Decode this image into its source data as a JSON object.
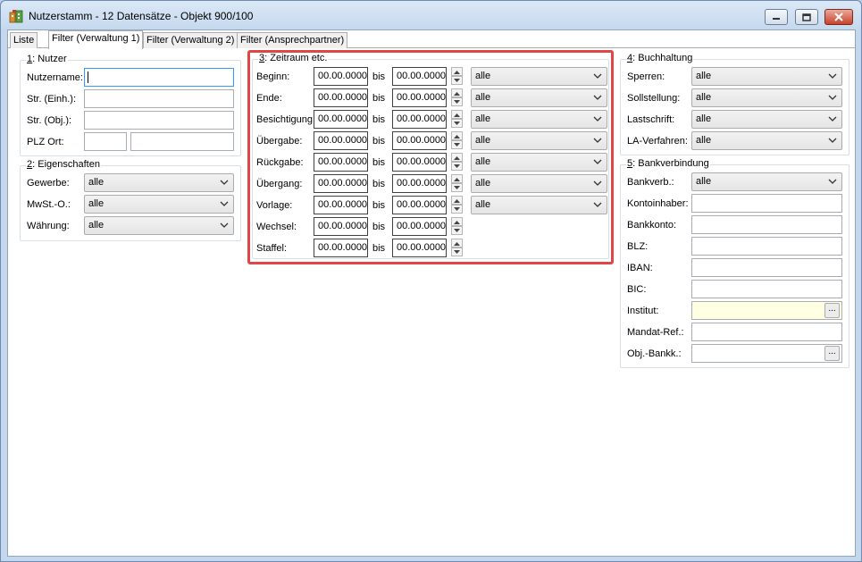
{
  "window": {
    "title": "Nutzerstamm - 12 Datensätze - Objekt 900/100"
  },
  "tabs": [
    "Liste",
    "Filter (Verwaltung 1)",
    "Filter (Verwaltung 2)",
    "Filter (Ansprechpartner)"
  ],
  "nutzer": {
    "title_num": "1",
    "title": ": Nutzer",
    "labels": [
      "Nutzername:",
      "Str. (Einh.):",
      "Str. (Obj.):",
      "PLZ Ort:"
    ]
  },
  "eigenschaften": {
    "title_num": "2",
    "title": ": Eigenschaften",
    "rows": [
      {
        "label": "Gewerbe:",
        "value": "alle"
      },
      {
        "label": "MwSt.-O.:",
        "value": "alle"
      },
      {
        "label": "Währung:",
        "value": "alle"
      }
    ]
  },
  "zeitraum": {
    "title_num": "3",
    "title": ": Zeitraum etc.",
    "bis": "bis",
    "rows": [
      {
        "label": "Beginn:",
        "from": "00.00.0000",
        "to": "00.00.0000",
        "select": "alle"
      },
      {
        "label": "Ende:",
        "from": "00.00.0000",
        "to": "00.00.0000",
        "select": "alle"
      },
      {
        "label": "Besichtigung:",
        "from": "00.00.0000",
        "to": "00.00.0000",
        "select": "alle"
      },
      {
        "label": "Übergabe:",
        "from": "00.00.0000",
        "to": "00.00.0000",
        "select": "alle"
      },
      {
        "label": "Rückgabe:",
        "from": "00.00.0000",
        "to": "00.00.0000",
        "select": "alle"
      },
      {
        "label": "Übergang:",
        "from": "00.00.0000",
        "to": "00.00.0000",
        "select": "alle"
      },
      {
        "label": "Vorlage:",
        "from": "00.00.0000",
        "to": "00.00.0000",
        "select": "alle"
      },
      {
        "label": "Wechsel:",
        "from": "00.00.0000",
        "to": "00.00.0000"
      },
      {
        "label": "Staffel:",
        "from": "00.00.0000",
        "to": "00.00.0000"
      }
    ]
  },
  "buchhaltung": {
    "title_num": "4",
    "title": ": Buchhaltung",
    "rows": [
      {
        "label": "Sperren:",
        "value": "alle"
      },
      {
        "label": "Sollstellung:",
        "value": "alle"
      },
      {
        "label": "Lastschrift:",
        "value": "alle"
      },
      {
        "label": "LA-Verfahren:",
        "value": "alle"
      }
    ]
  },
  "bankverbindung": {
    "title_num": "5",
    "title": ": Bankverbindung",
    "bankverb": {
      "label": "Bankverb.:",
      "value": "alle"
    },
    "labels": [
      "Kontoinhaber:",
      "Bankkonto:",
      "BLZ:",
      "IBAN:",
      "BIC:",
      "Institut:",
      "Mandat-Ref.:",
      "Obj.-Bankk.:"
    ],
    "ellipsis": "..."
  },
  "colors": {
    "highlight": "#e04646",
    "focus": "#3399ff",
    "institut_bg": "#ffffe1"
  }
}
